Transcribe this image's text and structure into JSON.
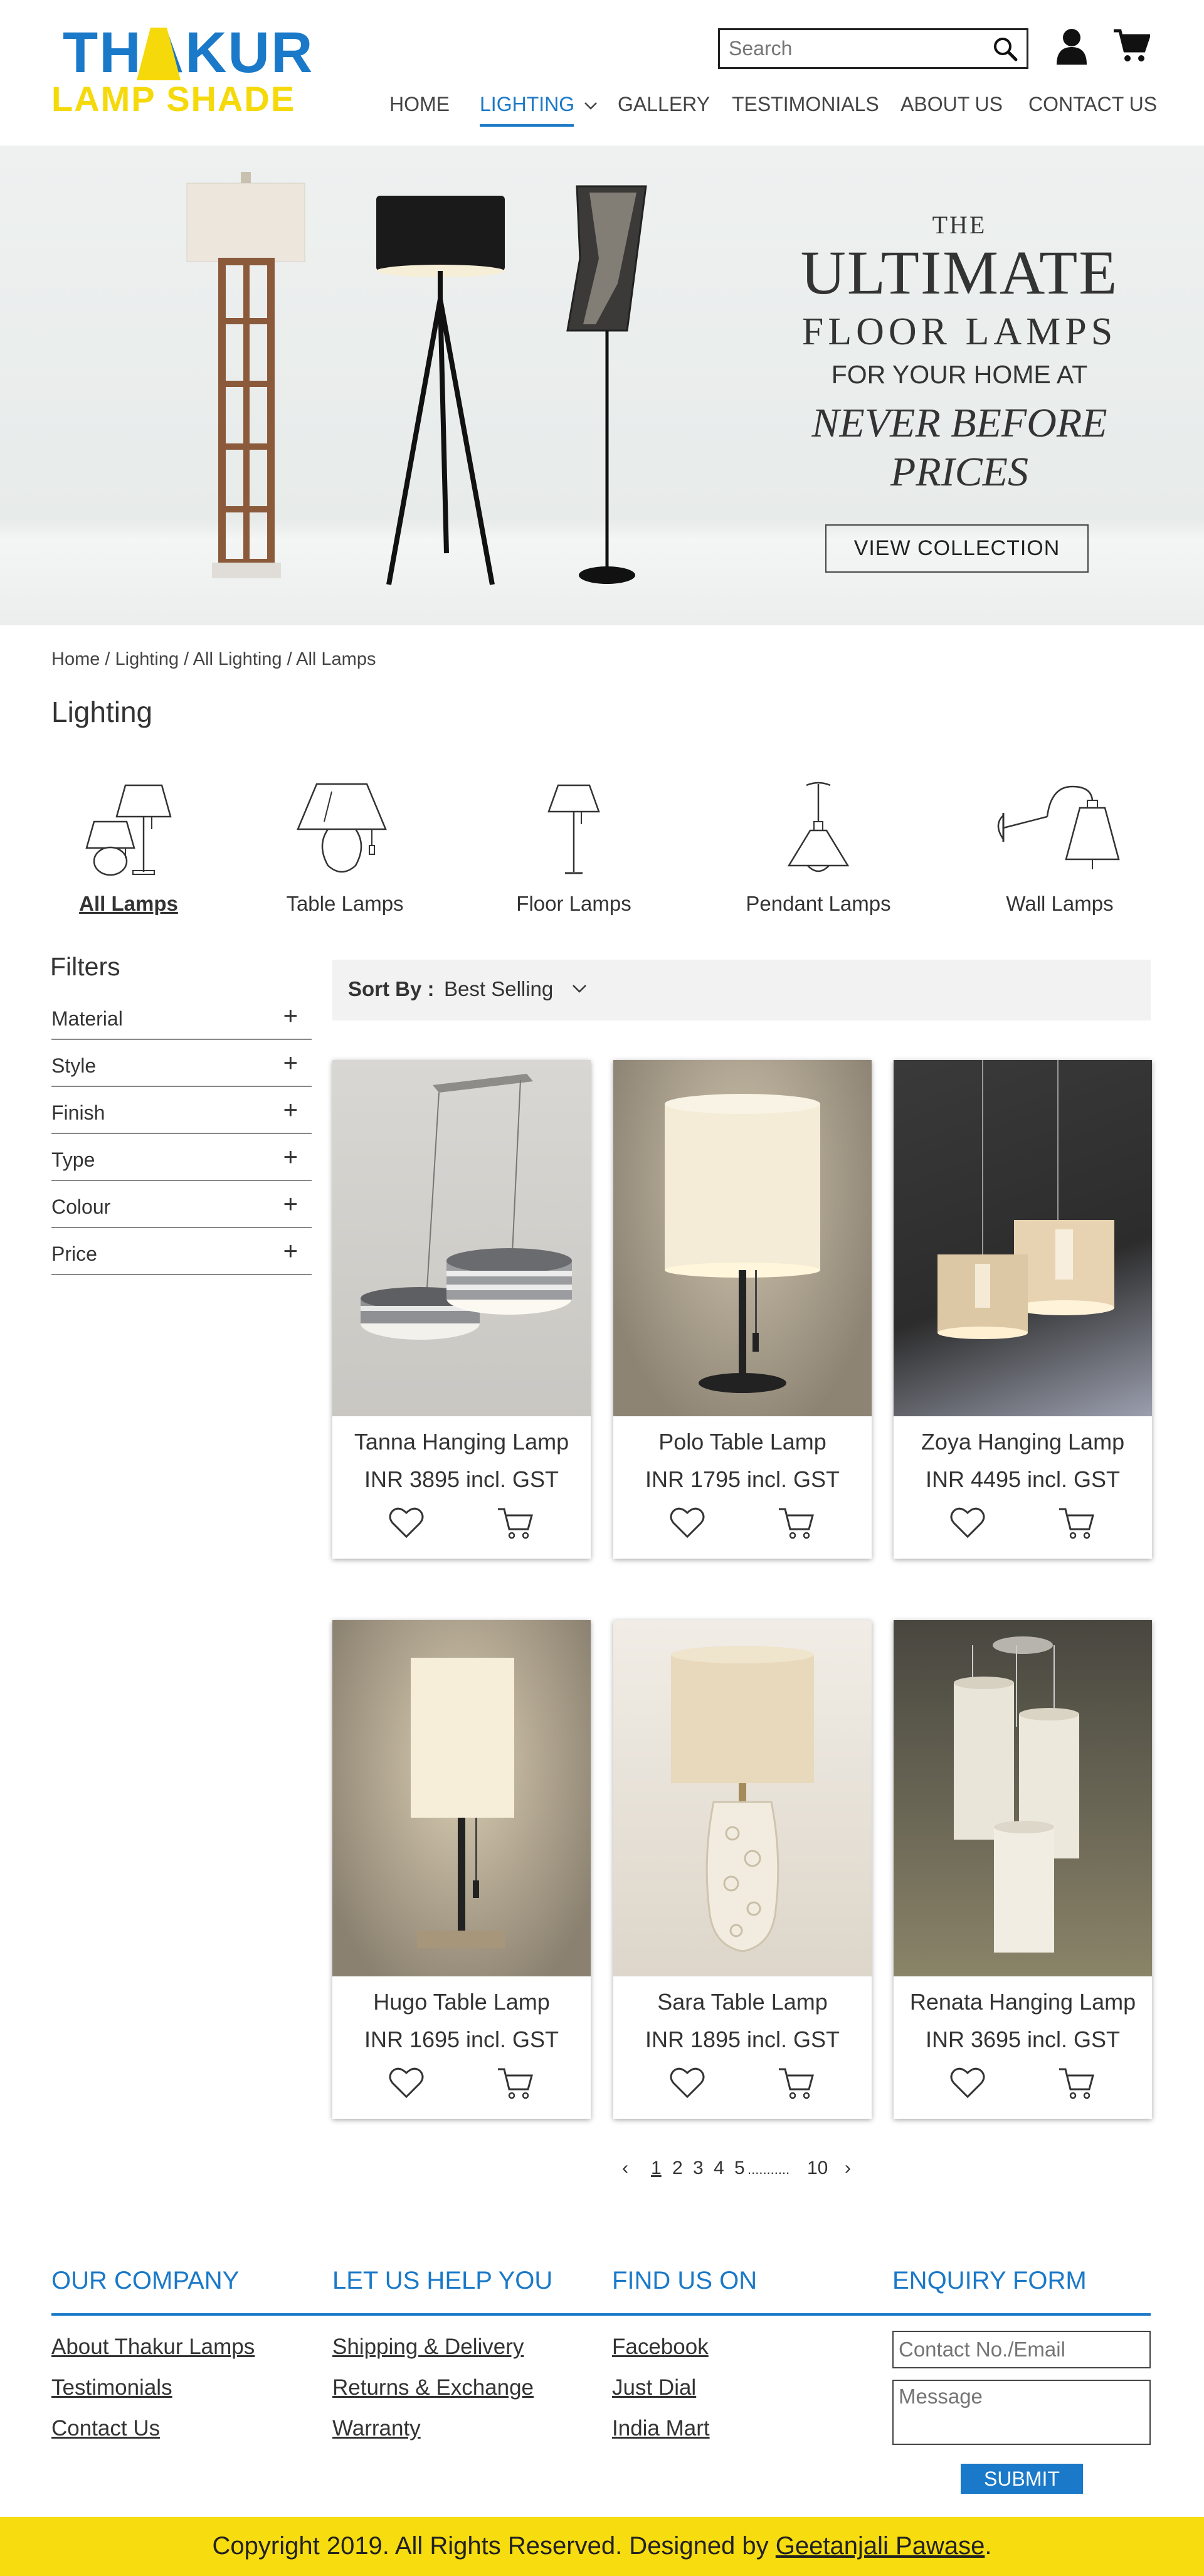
{
  "header": {
    "logo_top": "THAKUR",
    "logo_bottom": "LAMP SHADE",
    "search_placeholder": "Search",
    "nav": [
      "HOME",
      "LIGHTING",
      "GALLERY",
      "TESTIMONIALS",
      "ABOUT US",
      "CONTACT US"
    ],
    "active_nav": "LIGHTING"
  },
  "hero": {
    "line1": "THE",
    "line2": "ULTIMATE",
    "line3": "FLOOR LAMPS",
    "line4": "FOR YOUR HOME AT",
    "line5": "NEVER BEFORE PRICES",
    "button": "VIEW COLLECTION"
  },
  "breadcrumb": "Home / Lighting / All Lighting / All Lamps",
  "page_title": "Lighting",
  "categories": [
    {
      "label": "All Lamps",
      "icon": "all-lamps-icon",
      "active": true
    },
    {
      "label": "Table Lamps",
      "icon": "table-lamp-icon",
      "active": false
    },
    {
      "label": "Floor Lamps",
      "icon": "floor-lamp-icon",
      "active": false
    },
    {
      "label": "Pendant Lamps",
      "icon": "pendant-lamp-icon",
      "active": false
    },
    {
      "label": "Wall Lamps",
      "icon": "wall-lamp-icon",
      "active": false
    }
  ],
  "filters": {
    "title": "Filters",
    "items": [
      "Material",
      "Style",
      "Finish",
      "Type",
      "Colour",
      "Price"
    ]
  },
  "sort": {
    "label": "Sort By :",
    "value": "Best Selling"
  },
  "products": [
    {
      "name": "Tanna Hanging Lamp",
      "price": "INR 3895 incl. GST"
    },
    {
      "name": "Polo Table Lamp",
      "price": "INR 1795 incl. GST"
    },
    {
      "name": "Zoya Hanging Lamp",
      "price": "INR 4495 incl. GST"
    },
    {
      "name": "Hugo Table Lamp",
      "price": "INR 1695 incl. GST"
    },
    {
      "name": "Sara Table Lamp",
      "price": "INR 1895 incl. GST"
    },
    {
      "name": "Renata Hanging Lamp",
      "price": "INR 3695 incl. GST"
    }
  ],
  "pagination": {
    "prev": "‹",
    "pages": [
      "1",
      "2",
      "3",
      "4",
      "5"
    ],
    "ellipsis": "...........",
    "last": "10",
    "next": "›",
    "current": "1"
  },
  "footer": {
    "col1": {
      "title": "OUR COMPANY",
      "links": [
        "About Thakur Lamps",
        "Testimonials",
        "Contact Us"
      ]
    },
    "col2": {
      "title": "LET US HELP YOU",
      "links": [
        "Shipping & Delivery",
        "Returns & Exchange",
        "Warranty"
      ]
    },
    "col3": {
      "title": "FIND US ON",
      "links": [
        "Facebook",
        "Just Dial",
        "India Mart"
      ]
    },
    "col4": {
      "title": "ENQUIRY FORM",
      "contact_placeholder": "Contact No./Email",
      "message_placeholder": "Message",
      "submit": "SUBMIT"
    },
    "copyright_text": "Copyright 2019. All Rights Reserved. Designed by",
    "designer": "Geetanjali Pawase",
    "copyright_end": "."
  },
  "colors": {
    "brand_blue": "#1a79c8",
    "brand_yellow": "#f5d90a",
    "footer_yellow": "#f7dc0f",
    "sort_bg": "#f2f2f2"
  }
}
